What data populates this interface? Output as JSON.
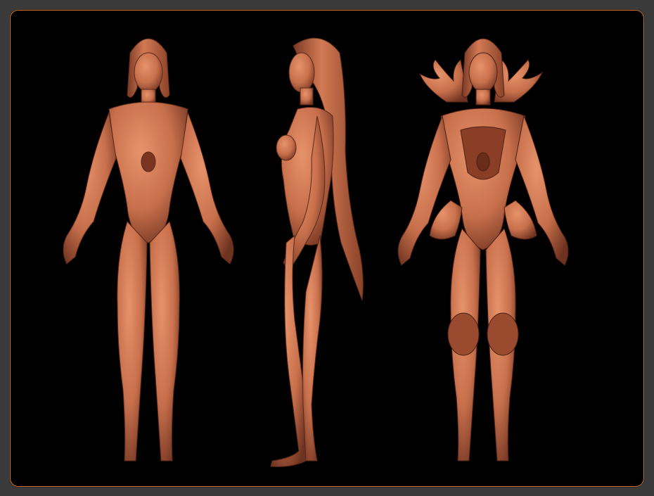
{
  "colors": {
    "page_background": "#3a3a3a",
    "canvas_background": "#000000",
    "frame_border": "#c8742e",
    "clay_light": "#e6936b",
    "clay_mid": "#c8704c",
    "clay_dark": "#6e3220"
  },
  "figures": [
    {
      "name": "front-view-nude-sculpt"
    },
    {
      "name": "side-view-sculpt"
    },
    {
      "name": "front-view-armored-sculpt"
    }
  ]
}
